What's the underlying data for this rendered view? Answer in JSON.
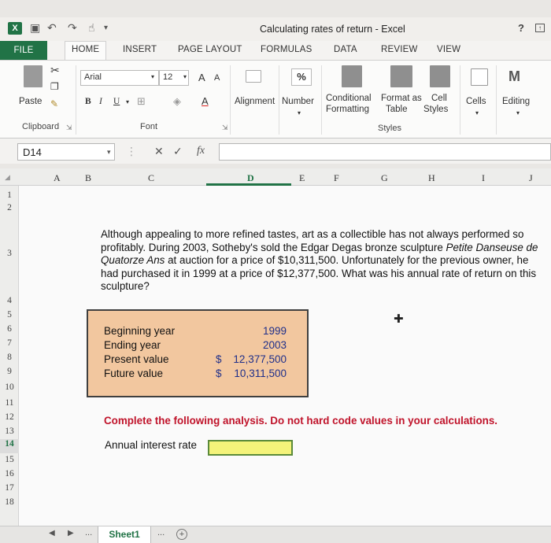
{
  "window": {
    "title": "Calculating rates of return - Excel",
    "help": "?",
    "app_icon": "excel-logo"
  },
  "quick_access": [
    "save-icon",
    "undo-icon",
    "redo-icon",
    "touch-mode-icon",
    "customize-icon"
  ],
  "tabs": [
    {
      "label": "FILE"
    },
    {
      "label": "HOME"
    },
    {
      "label": "INSERT"
    },
    {
      "label": "PAGE LAYOUT"
    },
    {
      "label": "FORMULAS"
    },
    {
      "label": "DATA"
    },
    {
      "label": "REVIEW"
    },
    {
      "label": "VIEW"
    }
  ],
  "ribbon": {
    "clipboard": {
      "paste": "Paste",
      "group": "Clipboard"
    },
    "font": {
      "name": "Arial",
      "size": "12",
      "bold": "B",
      "italic": "I",
      "underline": "U",
      "grow": "A",
      "shrink": "A",
      "group": "Font"
    },
    "alignment": {
      "label": "Alignment"
    },
    "number": {
      "label": "Number",
      "symbol": "%"
    },
    "styles": {
      "conditional_line1": "Conditional",
      "conditional_line2": "Formatting",
      "format_line1": "Format as",
      "format_line2": "Table",
      "cell_line1": "Cell",
      "cell_line2": "Styles",
      "group": "Styles"
    },
    "cells": {
      "label": "Cells"
    },
    "editing": {
      "label": "Editing"
    }
  },
  "formula_bar": {
    "name_box": "D14",
    "cancel": "✕",
    "enter": "✓",
    "fx": "fx",
    "value": ""
  },
  "columns": [
    "A",
    "B",
    "C",
    "D",
    "E",
    "F",
    "G",
    "H",
    "I",
    "J"
  ],
  "rows": [
    "1",
    "2",
    "3",
    "4",
    "5",
    "6",
    "7",
    "8",
    "9",
    "10",
    "11",
    "12",
    "13",
    "14",
    "15",
    "16",
    "17",
    "18"
  ],
  "selected_cell": "D14",
  "problem_text": "Although appealing to more refined tastes, art as a collectible has not always performed so profitably. During 2003, Sotheby's sold the Edgar Degas bronze sculpture Petite Danseuse de Quatorze Ans at auction for a price of $10,311,500. Unfortunately for the previous owner, he had purchased it in 1999 at a price of $12,377,500. What was his annual rate of return on this sculpture?",
  "problem_parts": {
    "before": "Although appealing to more refined tastes, art as a collectible has not always performed so profitably. During 2003, Sotheby's sold the Edgar Degas bronze sculpture ",
    "italic": "Petite Danseuse de Quatorze Ans",
    "after": " at auction for a price of $10,311,500. Unfortunately for the previous owner, he had purchased it in 1999 at a price of $12,377,500. What was his annual rate of return on this sculpture?"
  },
  "inputs": [
    {
      "label": "Beginning year",
      "currency": "",
      "value": "1999"
    },
    {
      "label": "Ending year",
      "currency": "",
      "value": "2003"
    },
    {
      "label": "Present value",
      "currency": "$",
      "value": "12,377,500"
    },
    {
      "label": "Future value",
      "currency": "$",
      "value": "10,311,500"
    }
  ],
  "instruction": "Complete the following analysis. Do not hard code values in your calculations.",
  "analysis": {
    "label": "Annual interest rate",
    "value": ""
  },
  "colors": {
    "excel_green": "#217346",
    "input_fill": "#f2c79f",
    "answer_fill": "#f4f37a",
    "instruction_red": "#c0142b",
    "value_blue": "#1f2f8a"
  },
  "sheets": [
    {
      "name": "Sheet1"
    }
  ],
  "sheet_nav": {
    "prev": "◀",
    "next": "▶",
    "more": "..."
  },
  "add_sheet": "+"
}
